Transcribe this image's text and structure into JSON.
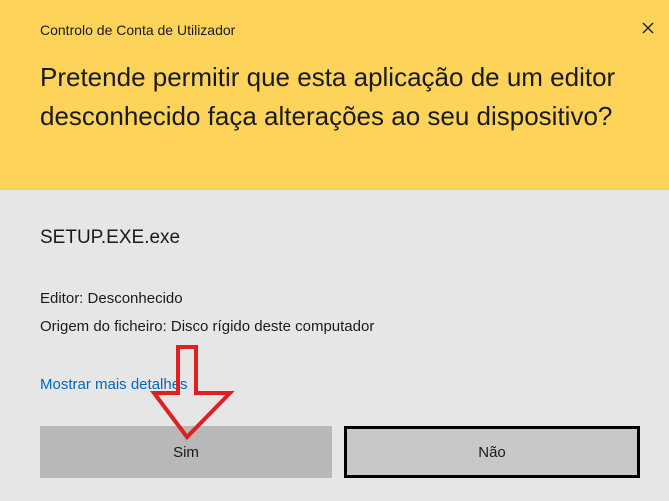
{
  "dialog": {
    "title": "Controlo de Conta de Utilizador",
    "question": "Pretende permitir que esta aplicação de um editor desconhecido faça alterações ao seu dispositivo?",
    "app_name": "SETUP.EXE.exe",
    "publisher": "Editor: Desconhecido",
    "origin": "Origem do ficheiro: Disco rígido deste computador",
    "details_link": "Mostrar mais detalhes",
    "yes_label": "Sim",
    "no_label": "Não"
  },
  "icons": {
    "close": "close-icon",
    "annotation": "red-down-arrow-icon"
  },
  "colors": {
    "header_bg": "#fdd35a",
    "body_bg": "#e6e6e6",
    "link": "#0067c0",
    "arrow": "#e02020"
  }
}
